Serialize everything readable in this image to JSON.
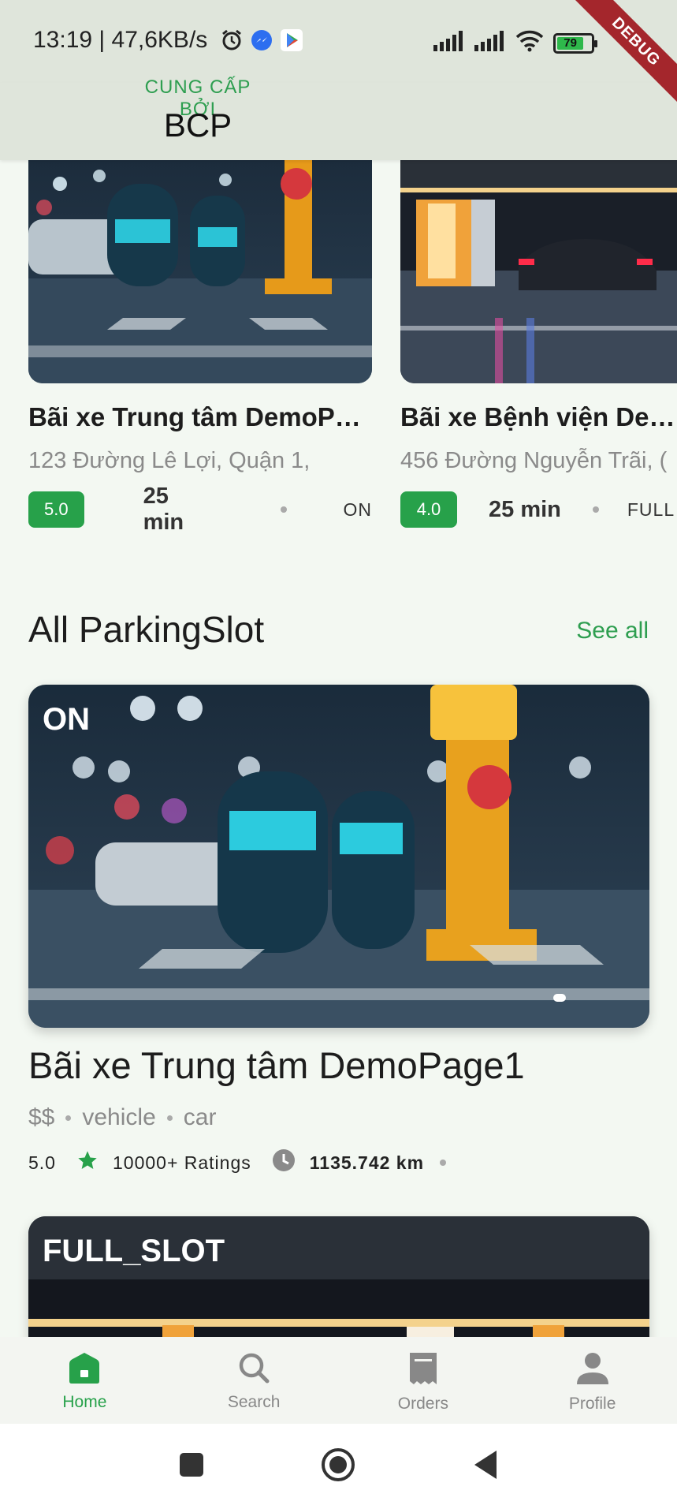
{
  "status_bar": {
    "time_speed": "13:19 | 47,6KB/s",
    "battery_level": "79",
    "icons": [
      "alarm-icon",
      "messenger-icon",
      "play-store-icon",
      "signal-icon",
      "signal-icon",
      "wifi-icon",
      "battery-icon"
    ]
  },
  "debug_banner": "DEBUG",
  "header": {
    "provider_label": "CUNG CẤP BỞI",
    "provider_name": "BCP"
  },
  "featured": [
    {
      "title": "Bãi xe Trung tâm DemoPa…",
      "address": "123 Đường Lê Lợi, Quận 1,",
      "rating": "5.0",
      "time": "25 min",
      "status": "ON"
    },
    {
      "title": "Bãi xe Bệnh viện Demo",
      "address": "456 Đường Nguyễn Trãi, (",
      "rating": "4.0",
      "time": "25 min",
      "status": "FULL"
    }
  ],
  "section": {
    "title": "All ParkingSlot",
    "see_all": "See all"
  },
  "slots": [
    {
      "status": "ON",
      "title": "Bãi xe Trung tâm DemoPage1",
      "price": "$$",
      "tag1": "vehicle",
      "tag2": "car",
      "rating": "5.0",
      "ratings_count": "10000+ Ratings",
      "distance": "1135.742 km"
    },
    {
      "status": "FULL_SLOT"
    }
  ],
  "bottom_nav": [
    {
      "label": "Home",
      "icon": "home-icon",
      "active": true
    },
    {
      "label": "Search",
      "icon": "search-icon",
      "active": false
    },
    {
      "label": "Orders",
      "icon": "orders-icon",
      "active": false
    },
    {
      "label": "Profile",
      "icon": "profile-icon",
      "active": false
    }
  ],
  "colors": {
    "accent": "#27a14a",
    "header_bg": "#dfe5db",
    "page_bg": "#f3f8f2"
  }
}
